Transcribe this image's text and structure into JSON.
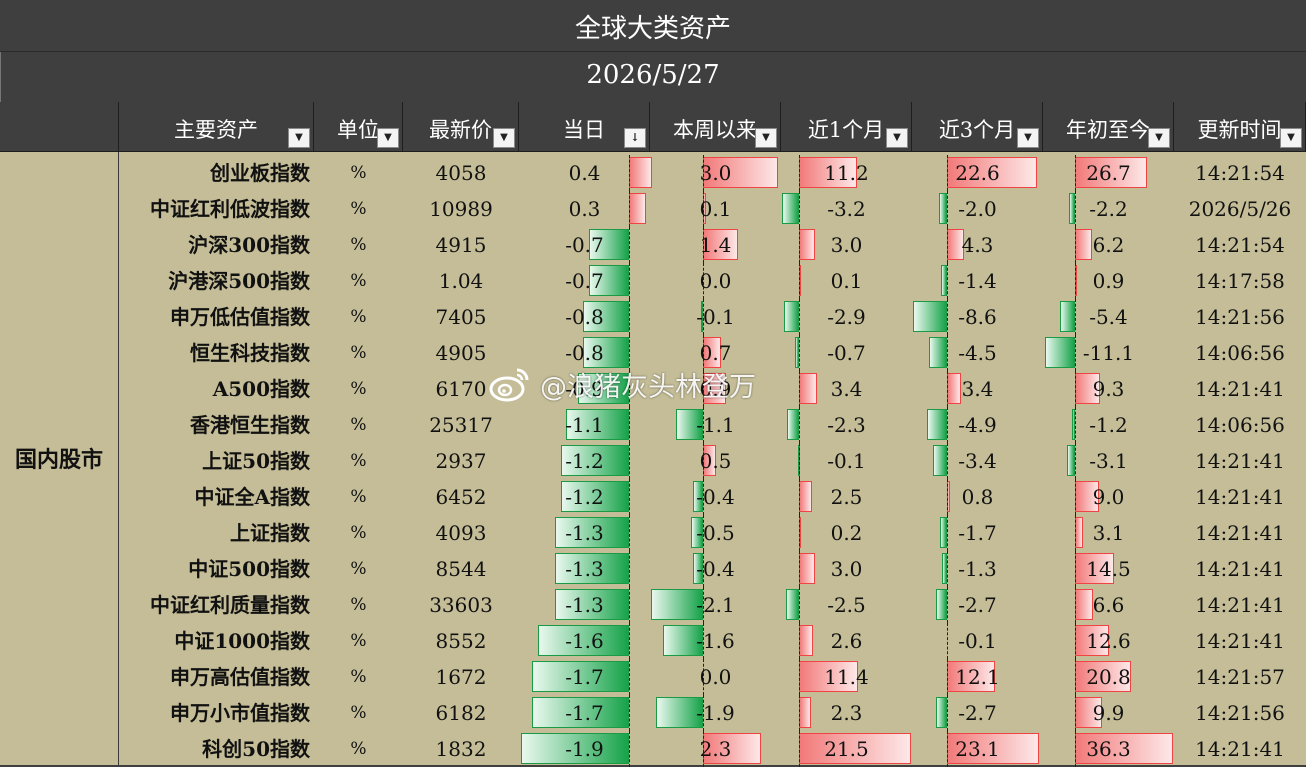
{
  "title": "全球大类资产",
  "date": "2026/5/27",
  "columns": [
    "主要资产",
    "单位",
    "最新价",
    "当日",
    "本周以来",
    "近1个月",
    "近3个月",
    "年初至今",
    "更新时间"
  ],
  "category": "国内股市",
  "watermark": "@浪猪灰头林登万",
  "sort_indicator": "↓",
  "filter_icon": "▼",
  "rows": [
    {
      "name": "创业板指数",
      "unit": "%",
      "price": "4058",
      "d": "0.4",
      "w": "3.0",
      "m1": "11.2",
      "m3": "22.6",
      "ytd": "26.7",
      "time": "14:21:54"
    },
    {
      "name": "中证红利低波指数",
      "unit": "%",
      "price": "10989",
      "d": "0.3",
      "w": "0.1",
      "m1": "-3.2",
      "m3": "-2.0",
      "ytd": "-2.2",
      "time": "2026/5/26"
    },
    {
      "name": "沪深300指数",
      "unit": "%",
      "price": "4915",
      "d": "-0.7",
      "w": "1.4",
      "m1": "3.0",
      "m3": "4.3",
      "ytd": "6.2",
      "time": "14:21:54"
    },
    {
      "name": "沪港深500指数",
      "unit": "%",
      "price": "1.04",
      "d": "-0.7",
      "w": "0.0",
      "m1": "0.1",
      "m3": "-1.4",
      "ytd": "0.9",
      "time": "14:17:58"
    },
    {
      "name": "申万低估值指数",
      "unit": "%",
      "price": "7405",
      "d": "-0.8",
      "w": "-0.1",
      "m1": "-2.9",
      "m3": "-8.6",
      "ytd": "-5.4",
      "time": "14:21:56"
    },
    {
      "name": "恒生科技指数",
      "unit": "%",
      "price": "4905",
      "d": "-0.8",
      "w": "0.7",
      "m1": "-0.7",
      "m3": "-4.5",
      "ytd": "-11.1",
      "time": "14:06:56"
    },
    {
      "name": "A500指数",
      "unit": "%",
      "price": "6170",
      "d": "-0.9",
      "w": "0.9",
      "m1": "3.4",
      "m3": "3.4",
      "ytd": "9.3",
      "time": "14:21:41"
    },
    {
      "name": "香港恒生指数",
      "unit": "%",
      "price": "25317",
      "d": "-1.1",
      "w": "-1.1",
      "m1": "-2.3",
      "m3": "-4.9",
      "ytd": "-1.2",
      "time": "14:06:56"
    },
    {
      "name": "上证50指数",
      "unit": "%",
      "price": "2937",
      "d": "-1.2",
      "w": "0.5",
      "m1": "-0.1",
      "m3": "-3.4",
      "ytd": "-3.1",
      "time": "14:21:41"
    },
    {
      "name": "中证全A指数",
      "unit": "%",
      "price": "6452",
      "d": "-1.2",
      "w": "-0.4",
      "m1": "2.5",
      "m3": "0.8",
      "ytd": "9.0",
      "time": "14:21:41"
    },
    {
      "name": "上证指数",
      "unit": "%",
      "price": "4093",
      "d": "-1.3",
      "w": "-0.5",
      "m1": "0.2",
      "m3": "-1.7",
      "ytd": "3.1",
      "time": "14:21:41"
    },
    {
      "name": "中证500指数",
      "unit": "%",
      "price": "8544",
      "d": "-1.3",
      "w": "-0.4",
      "m1": "3.0",
      "m3": "-1.3",
      "ytd": "14.5",
      "time": "14:21:41"
    },
    {
      "name": "中证红利质量指数",
      "unit": "%",
      "price": "33603",
      "d": "-1.3",
      "w": "-2.1",
      "m1": "-2.5",
      "m3": "-2.7",
      "ytd": "6.6",
      "time": "14:21:41"
    },
    {
      "name": "中证1000指数",
      "unit": "%",
      "price": "8552",
      "d": "-1.6",
      "w": "-1.6",
      "m1": "2.6",
      "m3": "-0.1",
      "ytd": "12.6",
      "time": "14:21:41"
    },
    {
      "name": "申万高估值指数",
      "unit": "%",
      "price": "1672",
      "d": "-1.7",
      "w": "0.0",
      "m1": "11.4",
      "m3": "12.1",
      "ytd": "20.8",
      "time": "14:21:57"
    },
    {
      "name": "申万小市值指数",
      "unit": "%",
      "price": "6182",
      "d": "-1.7",
      "w": "-1.9",
      "m1": "2.3",
      "m3": "-2.7",
      "ytd": "9.9",
      "time": "14:21:56"
    },
    {
      "name": "科创50指数",
      "unit": "%",
      "price": "1832",
      "d": "-1.9",
      "w": "2.3",
      "m1": "21.5",
      "m3": "23.1",
      "ytd": "36.3",
      "time": "14:21:41"
    }
  ]
}
